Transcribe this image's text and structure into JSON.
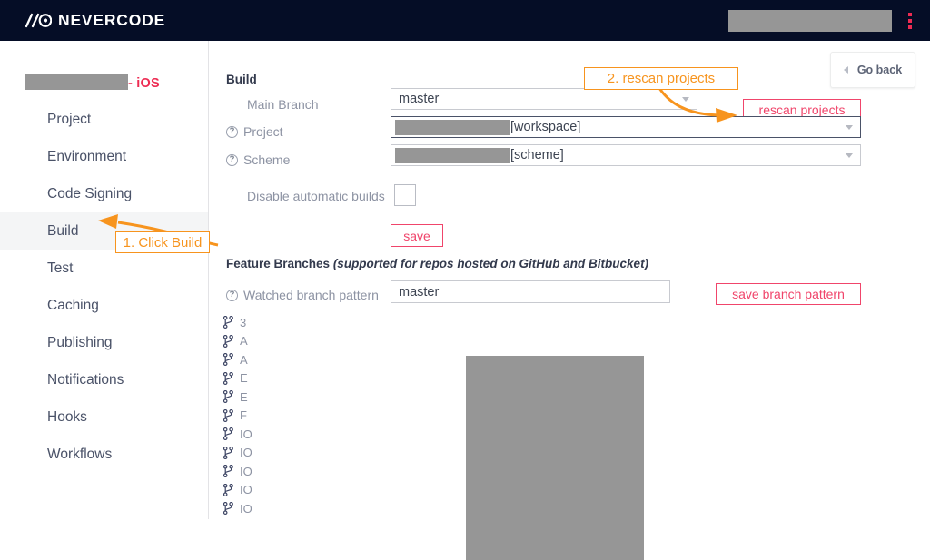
{
  "topbar": {
    "logo_text": "NEVERCODE",
    "logo_mark_icon": "slash-slash-circle-icon",
    "search_redacted": "",
    "kebab_icon": "vertical-dots-menu-icon"
  },
  "sidebar": {
    "project_name_redacted": "",
    "project_name_suffix": "- iOS",
    "items": [
      {
        "label": "Project",
        "active": false
      },
      {
        "label": "Environment",
        "active": false
      },
      {
        "label": "Code Signing",
        "active": false
      },
      {
        "label": "Build",
        "active": true
      },
      {
        "label": "Test",
        "active": false
      },
      {
        "label": "Caching",
        "active": false
      },
      {
        "label": "Publishing",
        "active": false
      },
      {
        "label": "Notifications",
        "active": false
      },
      {
        "label": "Hooks",
        "active": false
      },
      {
        "label": "Workflows",
        "active": false
      }
    ]
  },
  "main": {
    "go_back_label": "Go back",
    "go_back_icon": "chevron-left-icon",
    "build_heading": "Build",
    "fields": {
      "main_branch_label": "Main Branch",
      "main_branch_value": "master",
      "project_label": "Project",
      "project_value_suffix": "[workspace]",
      "scheme_label": "Scheme",
      "scheme_value_suffix": "[scheme]",
      "disable_auto_label": "Disable automatic builds",
      "disable_auto_checked": false
    },
    "rescan_label": "rescan projects",
    "save_label": "save",
    "feature_branches": {
      "heading": "Feature Branches",
      "heading_note": "(supported for repos hosted on GitHub and Bitbucket)",
      "watched_label": "Watched branch pattern",
      "watched_value": "master",
      "save_pattern_label": "save branch pattern"
    },
    "branches": [
      {
        "icon": "git-branch-icon",
        "prefix": "3"
      },
      {
        "icon": "git-branch-icon",
        "prefix": "A"
      },
      {
        "icon": "git-branch-icon",
        "prefix": "A"
      },
      {
        "icon": "git-branch-icon",
        "prefix": "E"
      },
      {
        "icon": "git-branch-icon",
        "prefix": "E"
      },
      {
        "icon": "git-branch-icon",
        "prefix": "F"
      },
      {
        "icon": "git-branch-icon",
        "prefix": "IO"
      },
      {
        "icon": "git-branch-icon",
        "prefix": "IO"
      },
      {
        "icon": "git-branch-icon",
        "prefix": "IO"
      },
      {
        "icon": "git-branch-icon",
        "prefix": "IO"
      },
      {
        "icon": "git-branch-icon",
        "prefix": "IO"
      }
    ]
  },
  "annotations": [
    {
      "id": "step1",
      "label": "1. Click Build"
    },
    {
      "id": "step2",
      "label": "2. rescan projects"
    }
  ],
  "colors": {
    "topbar_bg": "#050d26",
    "brand_pink": "#ed2b52",
    "button_pink": "#f0456b",
    "annotation_orange": "#f7941e",
    "sidebar_active_bg": "#f4f5f6",
    "label_gray": "#8d93a3",
    "redaction_gray": "#969696"
  }
}
